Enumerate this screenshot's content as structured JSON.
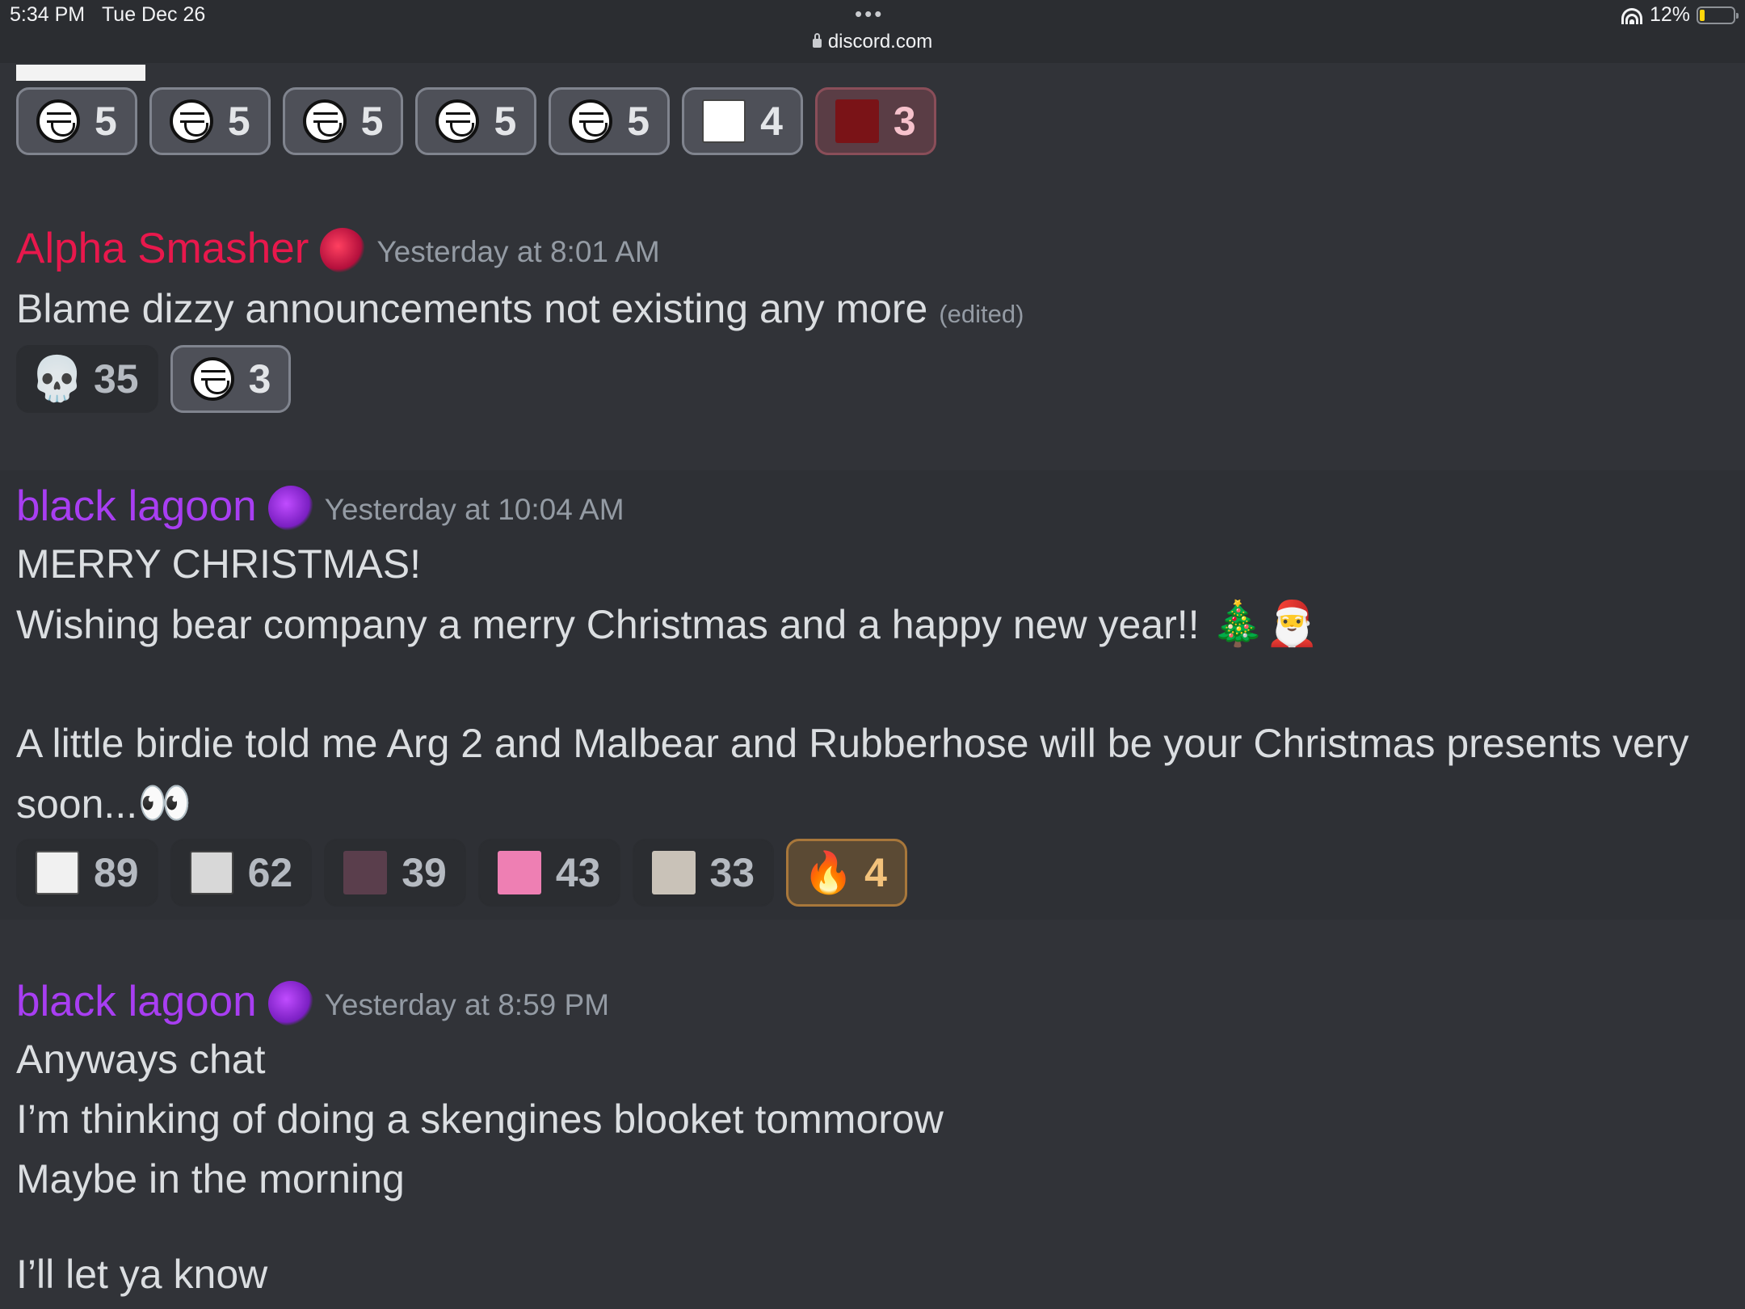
{
  "status_bar": {
    "time": "5:34 PM",
    "date": "Tue Dec 26",
    "url": "discord.com",
    "battery": "12%",
    "menu_dots": "•••"
  },
  "top_reactions": [
    {
      "emoji": "troll-face-icon",
      "count": "5",
      "style": "me"
    },
    {
      "emoji": "troll-face-icon",
      "count": "5",
      "style": "me"
    },
    {
      "emoji": "troll-face-icon",
      "count": "5",
      "style": "me"
    },
    {
      "emoji": "troll-face-icon",
      "count": "5",
      "style": "me"
    },
    {
      "emoji": "troll-face-icon",
      "count": "5",
      "style": "me"
    },
    {
      "emoji": "stick-figure-icon",
      "count": "4",
      "style": "me"
    },
    {
      "emoji": "red-anime-face-icon",
      "count": "3",
      "style": "red"
    }
  ],
  "messages": [
    {
      "author": "Alpha Smasher",
      "timestamp": "Yesterday at 8:01 AM",
      "lines": [
        "Blame dizzy announcements not existing any more"
      ],
      "edited_tag": "(edited)",
      "reactions": [
        {
          "emoji": "skull-icon",
          "count": "35"
        },
        {
          "emoji": "troll-face-icon",
          "count": "3"
        }
      ]
    },
    {
      "author": "black lagoon",
      "timestamp": "Yesterday at 10:04 AM",
      "lines": [
        "MERRY CHRISTMAS!",
        "Wishing bear company a merry Christmas and a happy new year!!",
        "A little birdie told me Arg 2 and Malbear and Rubberhose will be your Christmas presents very",
        "soon..."
      ],
      "inline_emoji": [
        "🎄",
        "🎅",
        "👀"
      ],
      "reactions": [
        {
          "emoji": "meme-reaction-icon",
          "count": "89"
        },
        {
          "emoji": "are-they-fr-meme-icon",
          "count": "62"
        },
        {
          "emoji": "santa-hat-meme-icon",
          "count": "39"
        },
        {
          "emoji": "pink-grin-face-icon",
          "count": "43"
        },
        {
          "emoji": "staring-face-icon",
          "count": "33"
        },
        {
          "emoji": "fire-icon",
          "glyph": "🔥",
          "count": "4"
        }
      ]
    },
    {
      "author": "black lagoon",
      "timestamp": "Yesterday at 8:59 PM",
      "lines": [
        "Anyways chat",
        "I’m thinking of doing a skengines blooket tommorow",
        "Maybe in the morning",
        "I’ll let ya know"
      ]
    }
  ],
  "colors": {
    "background": "#313338",
    "alpha_smasher": "#e8184c",
    "black_lagoon": "#a83ef2",
    "timestamp": "#949ba4"
  }
}
